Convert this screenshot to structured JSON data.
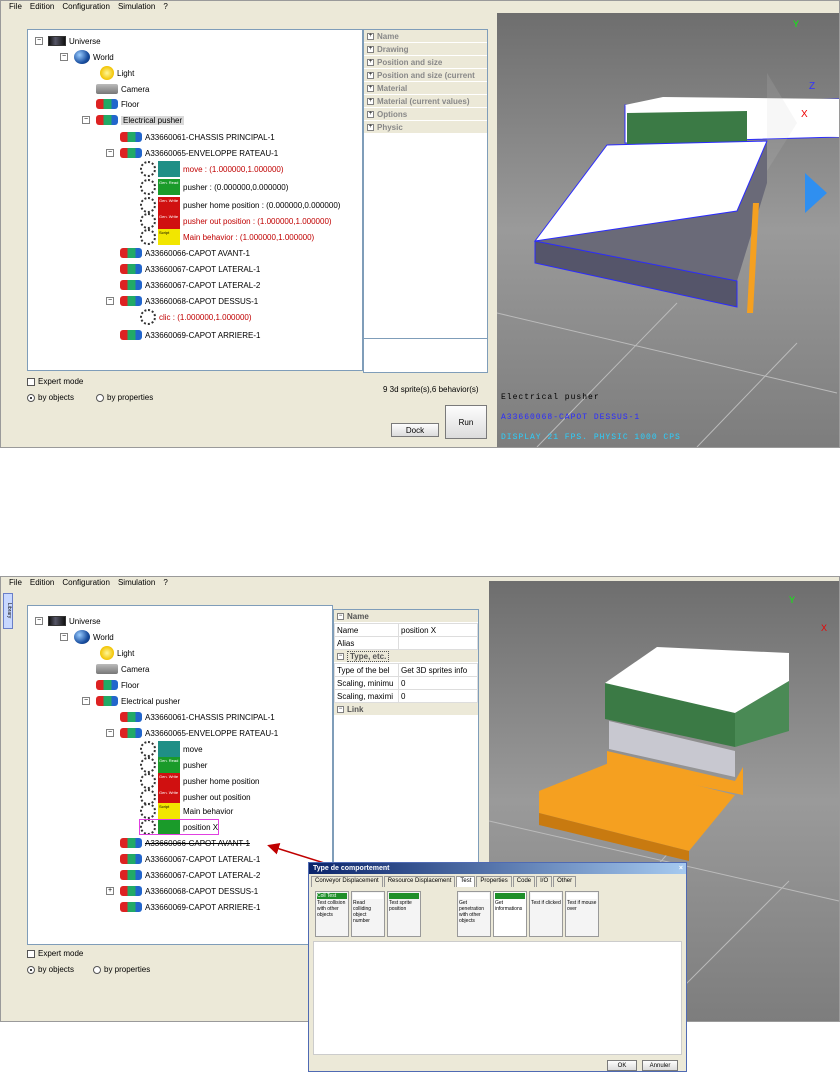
{
  "menu": [
    "File",
    "Edition",
    "Configuration",
    "Simulation",
    "?"
  ],
  "tree": {
    "universe": "Universe",
    "world": "World",
    "light": "Light",
    "camera": "Camera",
    "floor": "Floor",
    "pusher": "Electrical pusher",
    "chassis": "A33660061-CHASSIS PRINCIPAL-1",
    "enveloppe": "A33660065-ENVELOPPE RATEAU-1",
    "capot_avant": "A33660066-CAPOT AVANT-1",
    "capot_lat1": "A33660067-CAPOT LATERAL-1",
    "capot_lat2": "A33660067-CAPOT LATERAL-2",
    "capot_dessus": "A33660068-CAPOT DESSUS-1",
    "capot_arriere": "A33660069-CAPOT ARRIERE-1"
  },
  "top": {
    "behaviors": [
      {
        "label": "move : (1.000000,1.000000)",
        "chip": "",
        "color": "#1f8f86"
      },
      {
        "label": "pusher : (0.000000,0.000000)",
        "chip": "Gen. Read",
        "color": "#1a9b2a"
      },
      {
        "label": "pusher home position : (0.000000,0.000000)",
        "chip": "Gen. Write",
        "color": "#d01010"
      },
      {
        "label": "pusher out position : (1.000000,1.000000)",
        "chip": "Gen. Write",
        "color": "#d01010"
      },
      {
        "label": "Main behavior : (1.000000,1.000000)",
        "chip": "Script",
        "color": "#f2e600"
      }
    ],
    "clic": "clic : (1.000000,1.000000)",
    "props": [
      "Name",
      "Drawing",
      "Position and size",
      "Position and size (current",
      "Material",
      "Material (current values)",
      "Options",
      "Physic"
    ],
    "expert": "Expert mode",
    "by_objects": "by objects",
    "by_properties": "by properties",
    "status": "9 3d sprite(s),6 behavior(s)",
    "dock": "Dock",
    "run": "Run",
    "hud1": "Electrical pusher",
    "hud2": "A33660068-CAPOT DESSUS-1",
    "hud3": "DISPLAY 21 FPS. PHYSIC 1000 CPS"
  },
  "bottom": {
    "behaviors": [
      "move",
      "pusher",
      "pusher home position",
      "pusher out position",
      "Main behavior",
      "position X"
    ],
    "chips": [
      {
        "chip": "",
        "color": "#1f8f86"
      },
      {
        "chip": "Gen. Read",
        "color": "#1a9b2a"
      },
      {
        "chip": "Gen. Write",
        "color": "#d01010"
      },
      {
        "chip": "Gen. Write",
        "color": "#d01010"
      },
      {
        "chip": "Script",
        "color": "#f2e600"
      },
      {
        "chip": "",
        "color": "#1a9b2a"
      }
    ],
    "side_tab": "Library",
    "props_sections": [
      "Name",
      "Type, etc.",
      "Link"
    ],
    "props_rows": [
      [
        "Name",
        "position X"
      ],
      [
        "Alias",
        ""
      ]
    ],
    "props_rows2": [
      [
        "Type of the bel",
        "Get 3D sprites info"
      ],
      [
        "Scaling, minimu",
        "0"
      ],
      [
        "Scaling, maximi",
        "0"
      ]
    ],
    "expert": "Expert mode",
    "by_objects": "by objects",
    "by_properties": "by properties"
  },
  "dialog": {
    "title": "Type de comportement",
    "tabs": [
      "Conveyor Displacement",
      "Resource Displacement",
      "Test",
      "Properties",
      "Code",
      "I/O",
      "Other"
    ],
    "tiles": [
      {
        "head": "Coll Test",
        "text": "Test collision with other objects"
      },
      {
        "head": "",
        "text": "Read colliding object number"
      },
      {
        "head": "",
        "text": "Test sprite position"
      },
      {
        "head": "",
        "text": "Get penetration with other objects"
      },
      {
        "head": "",
        "text": "Get informations"
      },
      {
        "head": "",
        "text": "Test if clicked"
      },
      {
        "head": "",
        "text": "Test if mouse over"
      }
    ],
    "ok": "OK",
    "cancel": "Annuler"
  }
}
